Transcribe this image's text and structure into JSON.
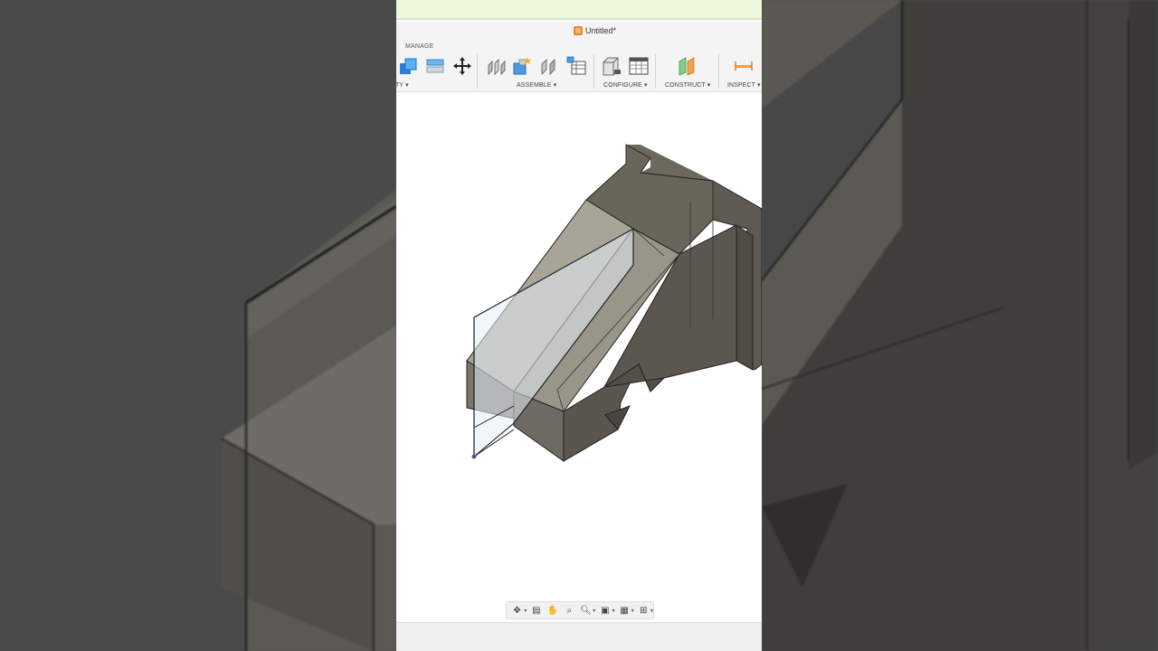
{
  "window": {
    "title": "Untitled*"
  },
  "toolbar": {
    "tab_label": "MANAGE",
    "groups": {
      "modify": "TY",
      "assemble": "ASSEMBLE",
      "configure": "CONFIGURE",
      "construct": "CONSTRUCT",
      "inspect": "INSPECT"
    }
  },
  "colors": {
    "accent": "#e8882a",
    "top_notification_bar": "#eef8dc",
    "model_face_light": "#a8a398",
    "model_face_dark": "#6f6a60",
    "sketch_plane": "#e3eef6"
  },
  "navigation_bar": {
    "icons": [
      "orbit-icon",
      "look-at-icon",
      "pan-icon",
      "zoom-window-icon",
      "zoom-icon",
      "display-settings-icon",
      "grid-icon",
      "viewports-icon"
    ]
  }
}
